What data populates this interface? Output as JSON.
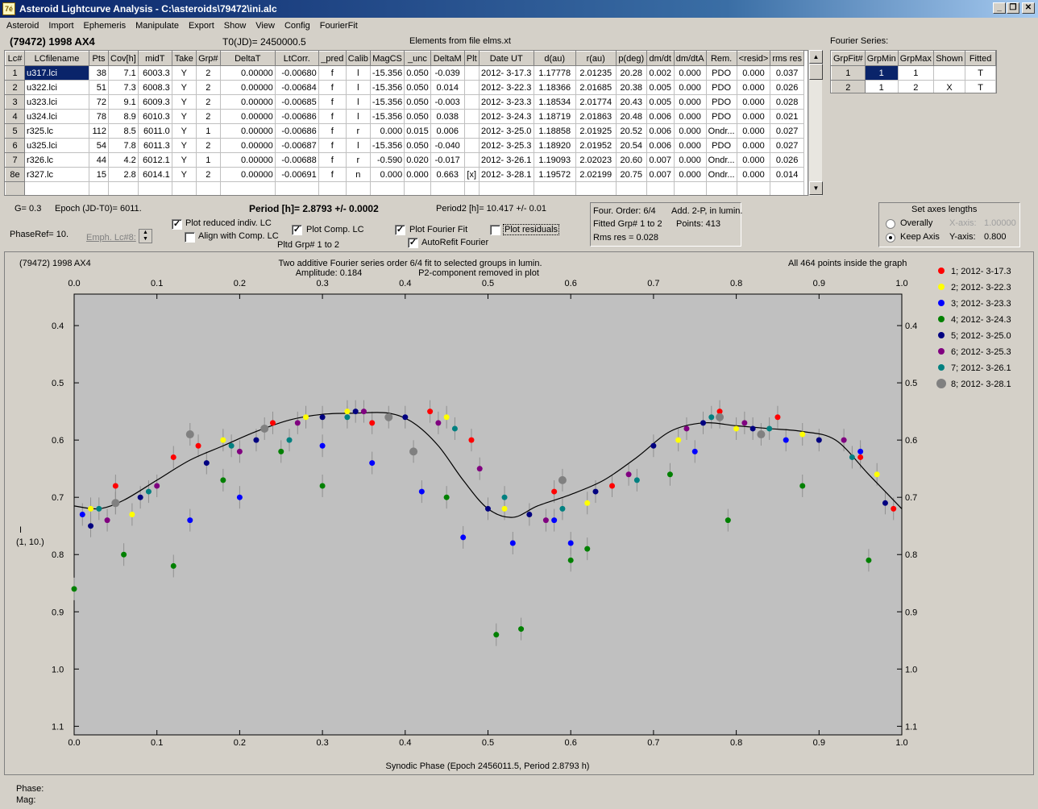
{
  "window": {
    "title": "Asteroid Lightcurve Analysis - C:\\asteroids\\79472\\ini.alc",
    "icon_label": "7é"
  },
  "menu": [
    "Asteroid",
    "Import",
    "Ephemeris",
    "Manipulate",
    "Export",
    "Show",
    "View",
    "Config",
    "FourierFit"
  ],
  "header": {
    "object": "(79472) 1998 AX4",
    "t0": "T0(JD)= 2450000.5",
    "elements": "Elements from file elms.xt"
  },
  "lc_table": {
    "columns": [
      "Lc#",
      "LCfilename",
      "Pts",
      "Cov[h]",
      "midT",
      "Take",
      "Grp#",
      "DeltaT",
      "LtCorr.",
      "_pred",
      "Calib",
      "MagCS",
      "_unc",
      "DeltaM",
      "Plt",
      "Date UT",
      "d(au)",
      "r(au)",
      "p(deg)",
      "dm/dt",
      "dm/dtA",
      "Rem.",
      "<resid>",
      "rms res"
    ],
    "rows": [
      [
        "1",
        "u317.lci",
        "38",
        "7.1",
        "6003.3",
        "Y",
        "2",
        "0.00000",
        "-0.00680",
        "f",
        "l",
        "-15.356",
        "0.050",
        "-0.039",
        "",
        "2012- 3-17.3",
        "1.17778",
        "2.01235",
        "20.28",
        "0.002",
        "0.000",
        "PDO",
        "0.000",
        "0.037"
      ],
      [
        "2",
        "u322.lci",
        "51",
        "7.3",
        "6008.3",
        "Y",
        "2",
        "0.00000",
        "-0.00684",
        "f",
        "l",
        "-15.356",
        "0.050",
        "0.014",
        "",
        "2012- 3-22.3",
        "1.18366",
        "2.01685",
        "20.38",
        "0.005",
        "0.000",
        "PDO",
        "0.000",
        "0.026"
      ],
      [
        "3",
        "u323.lci",
        "72",
        "9.1",
        "6009.3",
        "Y",
        "2",
        "0.00000",
        "-0.00685",
        "f",
        "l",
        "-15.356",
        "0.050",
        "-0.003",
        "",
        "2012- 3-23.3",
        "1.18534",
        "2.01774",
        "20.43",
        "0.005",
        "0.000",
        "PDO",
        "0.000",
        "0.028"
      ],
      [
        "4",
        "u324.lci",
        "78",
        "8.9",
        "6010.3",
        "Y",
        "2",
        "0.00000",
        "-0.00686",
        "f",
        "l",
        "-15.356",
        "0.050",
        "0.038",
        "",
        "2012- 3-24.3",
        "1.18719",
        "2.01863",
        "20.48",
        "0.006",
        "0.000",
        "PDO",
        "0.000",
        "0.021"
      ],
      [
        "5",
        "r325.lc",
        "112",
        "8.5",
        "6011.0",
        "Y",
        "1",
        "0.00000",
        "-0.00686",
        "f",
        "r",
        "0.000",
        "0.015",
        "0.006",
        "",
        "2012- 3-25.0",
        "1.18858",
        "2.01925",
        "20.52",
        "0.006",
        "0.000",
        "Ondr...",
        "0.000",
        "0.027"
      ],
      [
        "6",
        "u325.lci",
        "54",
        "7.8",
        "6011.3",
        "Y",
        "2",
        "0.00000",
        "-0.00687",
        "f",
        "l",
        "-15.356",
        "0.050",
        "-0.040",
        "",
        "2012- 3-25.3",
        "1.18920",
        "2.01952",
        "20.54",
        "0.006",
        "0.000",
        "PDO",
        "0.000",
        "0.027"
      ],
      [
        "7",
        "r326.lc",
        "44",
        "4.2",
        "6012.1",
        "Y",
        "1",
        "0.00000",
        "-0.00688",
        "f",
        "r",
        "-0.590",
        "0.020",
        "-0.017",
        "",
        "2012- 3-26.1",
        "1.19093",
        "2.02023",
        "20.60",
        "0.007",
        "0.000",
        "Ondr...",
        "0.000",
        "0.026"
      ],
      [
        "8e",
        "r327.lc",
        "15",
        "2.8",
        "6014.1",
        "Y",
        "2",
        "0.00000",
        "-0.00691",
        "f",
        "n",
        "0.000",
        "0.000",
        "0.663",
        "[x]",
        "2012- 3-28.1",
        "1.19572",
        "2.02199",
        "20.75",
        "0.007",
        "0.000",
        "Ondr...",
        "0.000",
        "0.014"
      ]
    ]
  },
  "fourier_table": {
    "caption": "Fourier Series:",
    "columns": [
      "GrpFit#",
      "GrpMin",
      "GrpMax",
      "Shown",
      "Fitted"
    ],
    "rows": [
      [
        "1",
        "1",
        "1",
        "",
        "T"
      ],
      [
        "2",
        "1",
        "2",
        "X",
        "T"
      ]
    ]
  },
  "params": {
    "g": "G= 0.3",
    "epoch": "Epoch (JD-T0)= 6011.",
    "period": "Period [h]= 2.8793 +/- 0.0002",
    "period2": "Period2 [h]= 10.417 +/- 0.01",
    "phaseref": "PhaseRef= 10.",
    "emph": "Emph. Lc#8:",
    "pltd_grp": "Pltd Grp#  1   to   2"
  },
  "checkboxes": {
    "plot_reduced": {
      "label": "Plot reduced indiv. LC",
      "checked": true
    },
    "align_comp": {
      "label": "Align with Comp. LC",
      "checked": false
    },
    "plot_comp": {
      "label": "Plot Comp. LC",
      "checked": true
    },
    "plot_fourier": {
      "label": "Plot Fourier Fit",
      "checked": true
    },
    "plot_residuals": {
      "label": "Plot residuals",
      "checked": false
    },
    "autorefit": {
      "label": "AutoRefit Fourier",
      "checked": true
    }
  },
  "fit_info": {
    "order": "Four. Order:  6/4",
    "add": "Add. 2-P, in lumin.",
    "fitted": "Fitted Grp# 1 to 2",
    "points": "Points: 413",
    "rms": "Rms res    = 0.028"
  },
  "axes_panel": {
    "title": "Set axes lengths",
    "overally": "Overally",
    "keep": "Keep Axis",
    "xlabel": "X-axis:",
    "xval": "1.00000",
    "ylabel": "Y-axis:",
    "yval": "0.800",
    "selected": "keep"
  },
  "plot_header": {
    "object": "(79472) 1998 AX4",
    "line1": "Two additive Fourier series order 6/4 fit to selected groups in lumin.",
    "amplitude": "Amplitude: 0.184",
    "p2": "P2-component removed in plot",
    "points_inside": "All 464 points inside the graph",
    "ylabel1": "I",
    "ylabel2": "(1, 10.)"
  },
  "legend": [
    {
      "label": "1; 2012- 3-17.3",
      "color": "#ff0000"
    },
    {
      "label": "2; 2012- 3-22.3",
      "color": "#ffff00"
    },
    {
      "label": "3; 2012- 3-23.3",
      "color": "#0000ff"
    },
    {
      "label": "4; 2012- 3-24.3",
      "color": "#008000"
    },
    {
      "label": "5; 2012- 3-25.0",
      "color": "#000080"
    },
    {
      "label": "6; 2012- 3-25.3",
      "color": "#800080"
    },
    {
      "label": "7; 2012- 3-26.1",
      "color": "#008080"
    },
    {
      "label": "8; 2012- 3-28.1",
      "color": "#808080"
    }
  ],
  "chart_data": {
    "type": "scatter",
    "xlabel": "Synodic Phase (Epoch 2456011.5, Period 2.8793 h)",
    "x_ticks": [
      "0.0",
      "0.1",
      "0.2",
      "0.3",
      "0.4",
      "0.5",
      "0.6",
      "0.7",
      "0.8",
      "0.9",
      "1.0"
    ],
    "y_ticks": [
      "0.4",
      "0.5",
      "0.6",
      "0.7",
      "0.8",
      "0.9",
      "1.0",
      "1.1"
    ],
    "xlim": [
      0.0,
      1.0
    ],
    "ylim": [
      0.345,
      1.115
    ],
    "y_inverted": true,
    "fit_curve": {
      "x": [
        0.0,
        0.03,
        0.06,
        0.1,
        0.14,
        0.18,
        0.22,
        0.26,
        0.3,
        0.34,
        0.38,
        0.41,
        0.44,
        0.47,
        0.5,
        0.53,
        0.56,
        0.6,
        0.64,
        0.68,
        0.72,
        0.76,
        0.8,
        0.84,
        0.88,
        0.92,
        0.96,
        1.0
      ],
      "y": [
        0.715,
        0.72,
        0.705,
        0.67,
        0.635,
        0.61,
        0.585,
        0.565,
        0.555,
        0.553,
        0.553,
        0.57,
        0.61,
        0.67,
        0.72,
        0.735,
        0.715,
        0.695,
        0.67,
        0.63,
        0.585,
        0.57,
        0.575,
        0.58,
        0.585,
        0.6,
        0.66,
        0.72
      ]
    },
    "series": [
      {
        "name": "1; 2012- 3-17.3",
        "x": [
          0.05,
          0.12,
          0.15,
          0.24,
          0.36,
          0.43,
          0.48,
          0.58,
          0.65,
          0.78,
          0.85,
          0.95,
          0.99
        ],
        "y": [
          0.68,
          0.63,
          0.61,
          0.57,
          0.57,
          0.55,
          0.6,
          0.69,
          0.68,
          0.55,
          0.56,
          0.63,
          0.72
        ]
      },
      {
        "name": "2; 2012- 3-22.3",
        "x": [
          0.02,
          0.07,
          0.18,
          0.28,
          0.33,
          0.45,
          0.52,
          0.62,
          0.73,
          0.8,
          0.88,
          0.97
        ],
        "y": [
          0.72,
          0.73,
          0.6,
          0.56,
          0.55,
          0.56,
          0.72,
          0.71,
          0.6,
          0.58,
          0.59,
          0.66
        ]
      },
      {
        "name": "3; 2012- 3-23.3",
        "x": [
          0.01,
          0.05,
          0.14,
          0.2,
          0.3,
          0.36,
          0.42,
          0.47,
          0.53,
          0.58,
          0.6,
          0.75,
          0.86,
          0.95
        ],
        "y": [
          0.73,
          0.71,
          0.74,
          0.7,
          0.61,
          0.64,
          0.69,
          0.77,
          0.78,
          0.74,
          0.78,
          0.62,
          0.6,
          0.62
        ]
      },
      {
        "name": "4; 2012- 3-24.3",
        "x": [
          0.0,
          0.06,
          0.12,
          0.18,
          0.25,
          0.3,
          0.45,
          0.51,
          0.54,
          0.6,
          0.62,
          0.72,
          0.79,
          0.88,
          0.96
        ],
        "y": [
          0.86,
          0.8,
          0.82,
          0.67,
          0.62,
          0.68,
          0.7,
          0.94,
          0.93,
          0.81,
          0.79,
          0.66,
          0.74,
          0.68,
          0.81
        ]
      },
      {
        "name": "5; 2012- 3-25.0",
        "x": [
          0.02,
          0.08,
          0.16,
          0.22,
          0.3,
          0.34,
          0.4,
          0.5,
          0.55,
          0.63,
          0.7,
          0.76,
          0.82,
          0.9,
          0.98
        ],
        "y": [
          0.75,
          0.7,
          0.64,
          0.6,
          0.56,
          0.55,
          0.56,
          0.72,
          0.73,
          0.69,
          0.61,
          0.57,
          0.58,
          0.6,
          0.71
        ]
      },
      {
        "name": "6; 2012- 3-25.3",
        "x": [
          0.04,
          0.1,
          0.2,
          0.27,
          0.35,
          0.44,
          0.49,
          0.57,
          0.67,
          0.74,
          0.81,
          0.93
        ],
        "y": [
          0.74,
          0.68,
          0.62,
          0.57,
          0.55,
          0.57,
          0.65,
          0.74,
          0.66,
          0.58,
          0.57,
          0.6
        ]
      },
      {
        "name": "7; 2012- 3-26.1",
        "x": [
          0.03,
          0.09,
          0.19,
          0.26,
          0.33,
          0.46,
          0.52,
          0.59,
          0.68,
          0.77,
          0.84,
          0.94
        ],
        "y": [
          0.72,
          0.69,
          0.61,
          0.6,
          0.56,
          0.58,
          0.7,
          0.72,
          0.67,
          0.56,
          0.58,
          0.63
        ]
      },
      {
        "name": "8; 2012- 3-28.1",
        "x": [
          0.05,
          0.14,
          0.23,
          0.38,
          0.41,
          0.59,
          0.78,
          0.83
        ],
        "y": [
          0.71,
          0.59,
          0.58,
          0.56,
          0.62,
          0.67,
          0.56,
          0.59
        ]
      }
    ]
  },
  "status": {
    "phase": "Phase:",
    "mag": "Mag:"
  }
}
